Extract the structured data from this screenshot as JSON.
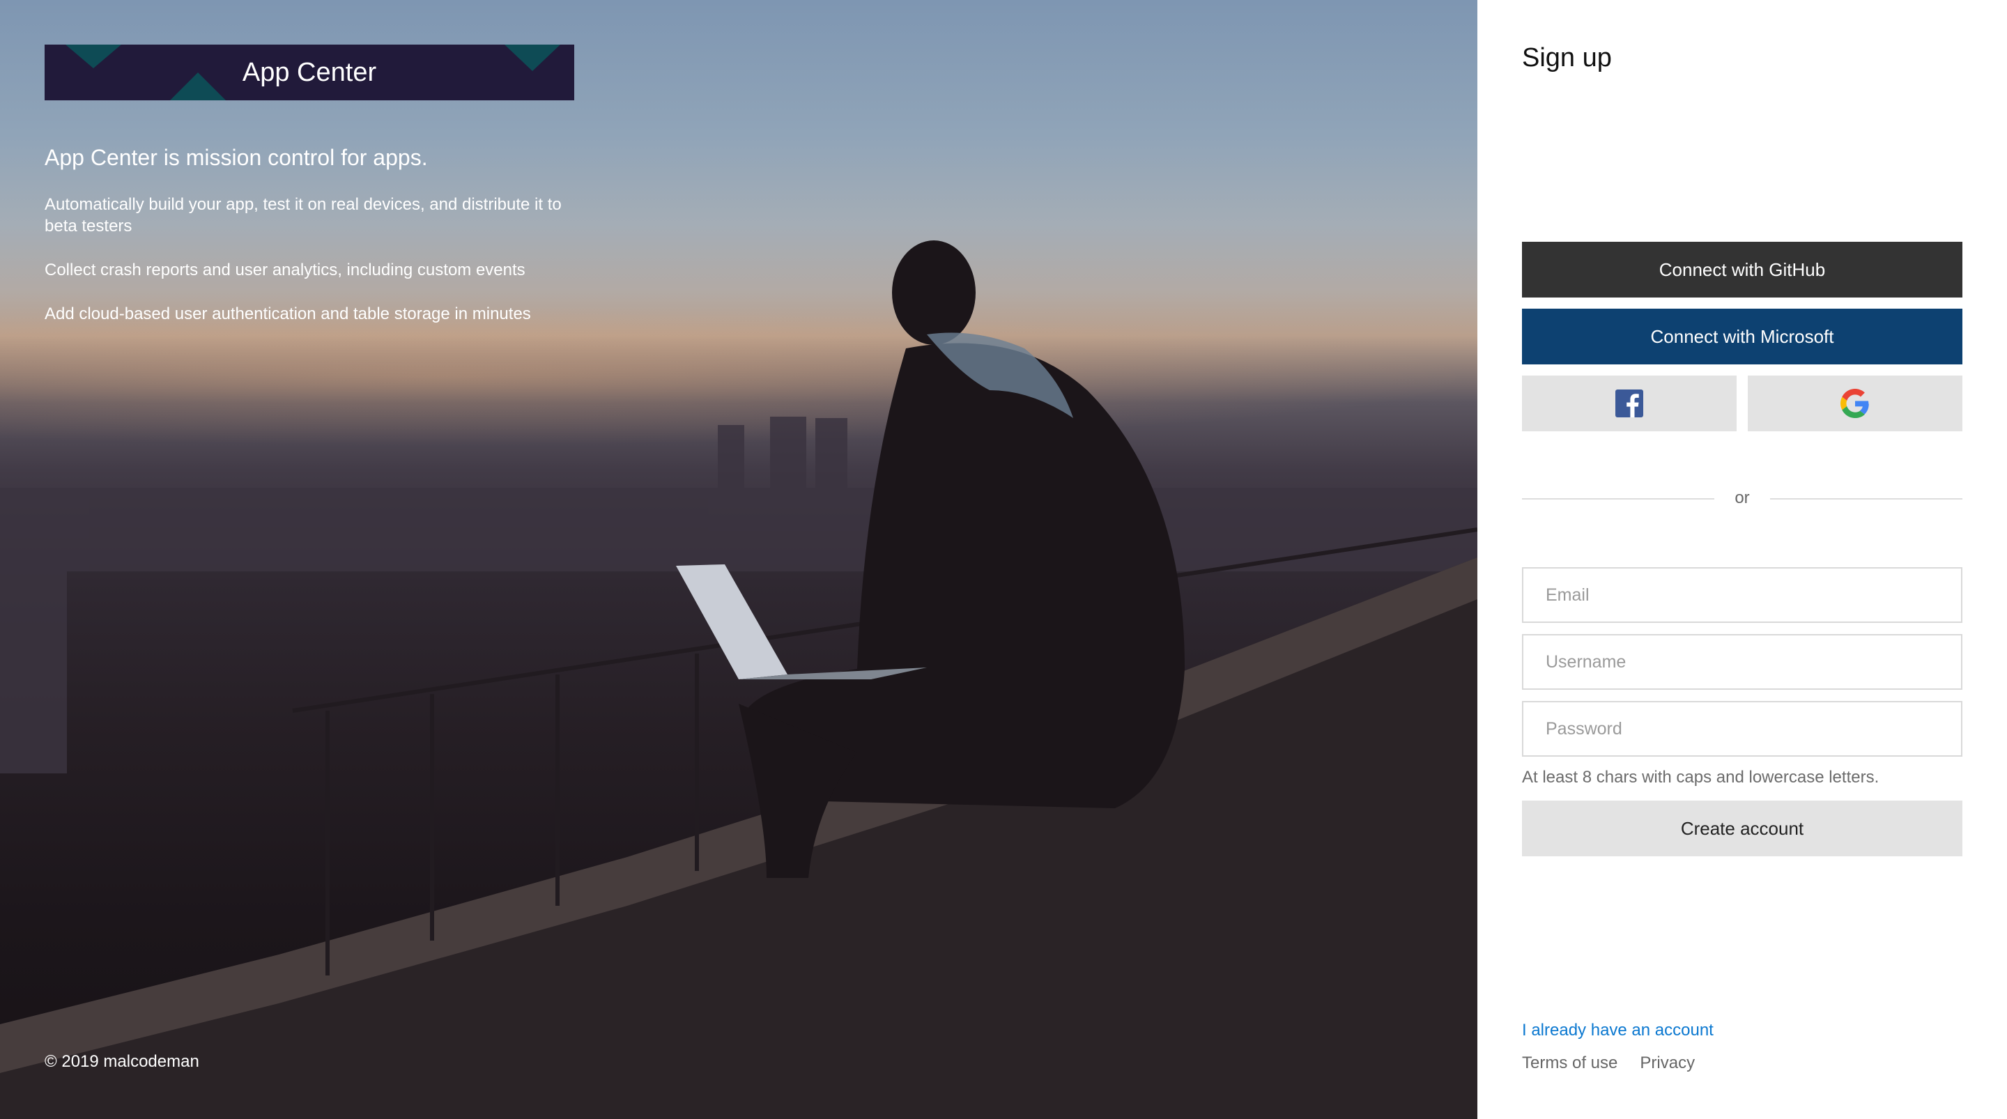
{
  "hero": {
    "brand_title": "App Center",
    "headline": "App Center is mission control for apps.",
    "bullets": [
      "Automatically build your app, test it on real devices, and distribute it to beta testers",
      "Collect crash reports and user analytics, including custom events",
      "Add cloud-based user authentication and table storage in minutes"
    ],
    "copyright": "© 2019 malcodeman"
  },
  "signup": {
    "title": "Sign up",
    "github_label": "Connect with GitHub",
    "microsoft_label": "Connect with Microsoft",
    "facebook_icon": "facebook-icon",
    "google_icon": "google-icon",
    "divider_text": "or",
    "email": {
      "placeholder": "Email",
      "value": ""
    },
    "username": {
      "placeholder": "Username",
      "value": ""
    },
    "password": {
      "placeholder": "Password",
      "value": ""
    },
    "password_hint": "At least 8 chars with caps and lowercase letters.",
    "create_label": "Create account",
    "signin_link": "I already have an account",
    "footer": {
      "terms": "Terms of use",
      "privacy": "Privacy"
    }
  },
  "colors": {
    "github_bg": "#333333",
    "microsoft_bg": "#0d4171",
    "brand_bar_bg": "#211a3a",
    "link": "#0b78d0",
    "facebook_blue": "#3b5998"
  }
}
